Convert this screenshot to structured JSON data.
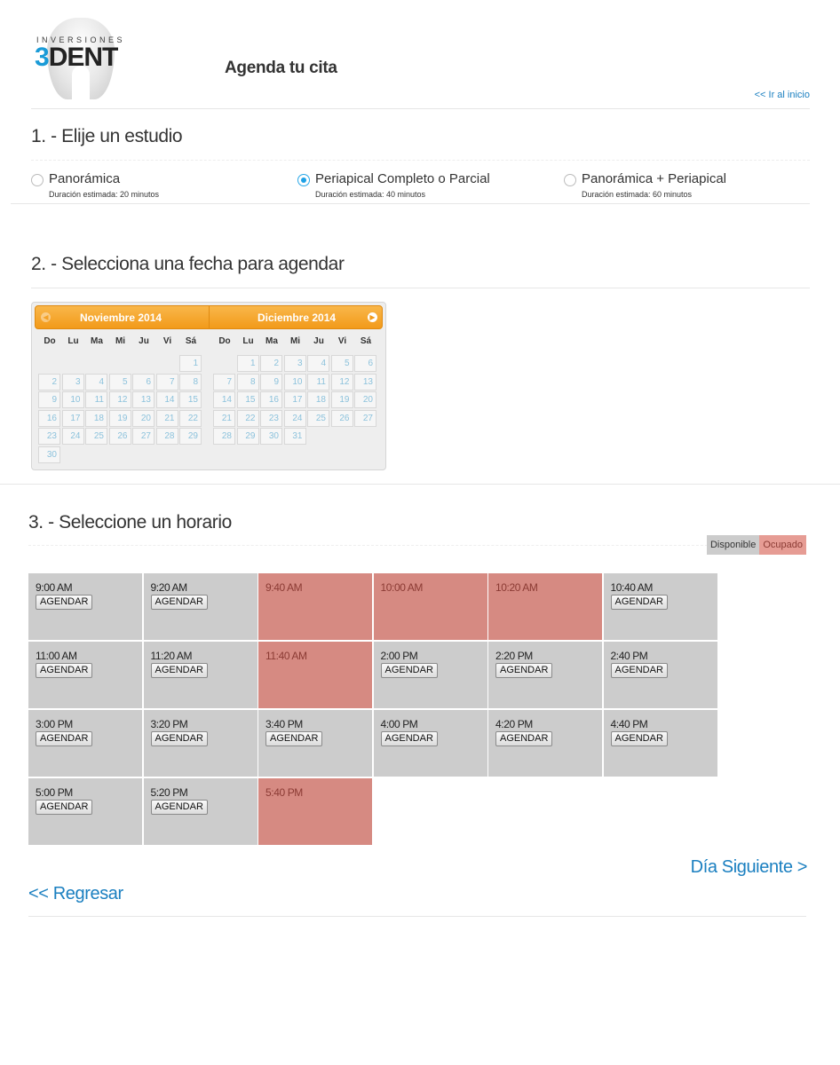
{
  "header": {
    "logo_sub": "INVERSIONES",
    "logo_three": "3",
    "logo_dent": "DENT",
    "page_title": "Agenda tu cita",
    "home_link": "<< Ir al inicio"
  },
  "step1": {
    "title": "1. - Elije un estudio",
    "options": [
      {
        "name": "Panorámica",
        "duration": "Duración estimada: 20 minutos",
        "checked": false
      },
      {
        "name": "Periapical Completo o Parcial",
        "duration": "Duración estimada: 40 minutos",
        "checked": true
      },
      {
        "name": "Panorámica + Periapical",
        "duration": "Duración estimada: 60 minutos",
        "checked": false
      }
    ]
  },
  "step2": {
    "title": "2. - Selecciona una fecha para agendar",
    "weekdays": [
      "Do",
      "Lu",
      "Ma",
      "Mi",
      "Ju",
      "Vi",
      "Sá"
    ],
    "months": [
      {
        "name": "Noviembre 2014",
        "first_weekday": 6,
        "days": 30
      },
      {
        "name": "Diciembre 2014",
        "first_weekday": 1,
        "days": 31
      }
    ],
    "prev_icon": "chevron-left-icon",
    "next_icon": "chevron-right-icon"
  },
  "step3": {
    "title": "3. - Seleccione un horario",
    "legend_available": "Disponible",
    "legend_busy": "Ocupado",
    "button_label": "AGENDAR",
    "colors": {
      "available": "#cccccc",
      "busy": "#d68a82"
    },
    "slots": [
      {
        "time": "9:00 AM",
        "busy": false
      },
      {
        "time": "9:20 AM",
        "busy": false
      },
      {
        "time": "9:40 AM",
        "busy": true
      },
      {
        "time": "10:00 AM",
        "busy": true
      },
      {
        "time": "10:20 AM",
        "busy": true
      },
      {
        "time": "10:40 AM",
        "busy": false
      },
      {
        "time": "11:00 AM",
        "busy": false
      },
      {
        "time": "11:20 AM",
        "busy": false
      },
      {
        "time": "11:40 AM",
        "busy": true
      },
      {
        "time": "2:00 PM",
        "busy": false
      },
      {
        "time": "2:20 PM",
        "busy": false
      },
      {
        "time": "2:40 PM",
        "busy": false
      },
      {
        "time": "3:00 PM",
        "busy": false
      },
      {
        "time": "3:20 PM",
        "busy": false
      },
      {
        "time": "3:40 PM",
        "busy": false
      },
      {
        "time": "4:00 PM",
        "busy": false
      },
      {
        "time": "4:20 PM",
        "busy": false
      },
      {
        "time": "4:40 PM",
        "busy": false
      },
      {
        "time": "5:00 PM",
        "busy": false
      },
      {
        "time": "5:20 PM",
        "busy": false
      },
      {
        "time": "5:40 PM",
        "busy": true
      }
    ]
  },
  "nav": {
    "next_day": "Día Siguiente >",
    "back": "<< Regresar"
  }
}
